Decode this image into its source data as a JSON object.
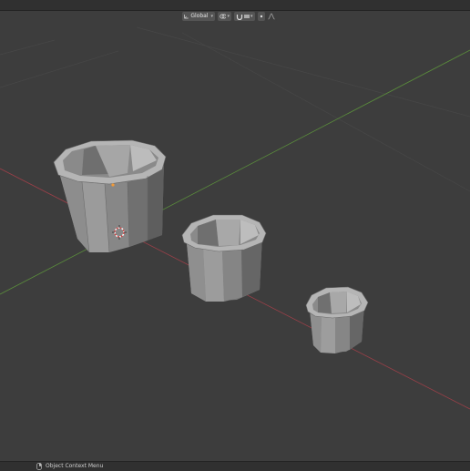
{
  "header": {
    "orientation": {
      "label": "Global",
      "icon": "transform-orientation-icon"
    },
    "pivot": {
      "icon": "pivot-point-icon"
    },
    "snap": {
      "icon": "snap-icon"
    },
    "proportional": {
      "icon": "proportional-editing-icon"
    }
  },
  "viewport": {
    "objects": [
      "pot-large",
      "pot-medium",
      "pot-small"
    ],
    "axes": {
      "x_color": "#9a3f48",
      "y_color": "#5a8c3c"
    },
    "grid_color": "#474747",
    "origin_color": "#f29a38",
    "cursor": "3d-cursor-icon"
  },
  "status": {
    "mouse_icon": "mouse-right-click-icon",
    "text": "Object Context Menu"
  }
}
